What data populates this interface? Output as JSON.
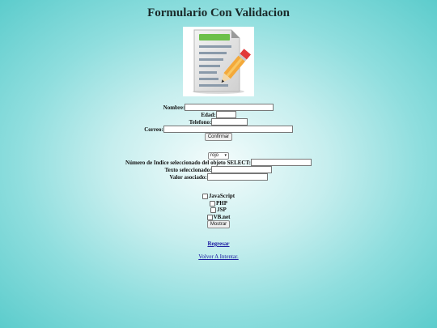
{
  "title": "Formulario Con Validacion",
  "logo_icon": "document-pencil-icon",
  "form": {
    "nombre_label": "Nombre:",
    "edad_label": "Edad:",
    "telefono_label": "Telefono:",
    "correo_label": "Correo:",
    "confirm_label": "Confirmar"
  },
  "select_section": {
    "select_value": "rojo",
    "index_label": "Número de Indice seleccionado del objeto SELECT:",
    "texto_label": "Texto seleccionado:",
    "valor_label": "Valor asociado:"
  },
  "checkboxes": {
    "items": [
      "JavaScript",
      "PHP",
      "JSP",
      "VB.net"
    ],
    "mostrar_label": "Mostrar"
  },
  "links": {
    "regresar": "Regresar",
    "volver": "Volver A Intentar."
  }
}
